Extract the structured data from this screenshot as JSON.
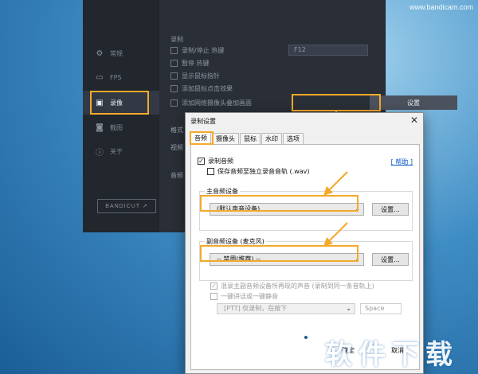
{
  "watermark_top": "www.bandicam.com",
  "main_window": {
    "sidebar": {
      "items": [
        {
          "label": "常规",
          "icon": "gear-icon"
        },
        {
          "label": "FPS",
          "icon": "fps-icon"
        },
        {
          "label": "录像",
          "icon": "video-icon"
        },
        {
          "label": "截图",
          "icon": "camera-icon"
        },
        {
          "label": "关于",
          "icon": "info-icon"
        }
      ],
      "bandicut": "BANDICUT ↗"
    },
    "section_title": "录制",
    "options": [
      "录制/停止 热键",
      "暂停 热键",
      "显示鼠标指针",
      "添加鼠标点击效果",
      "添加网络摄像头叠加画面"
    ],
    "hotkey_value": "F12",
    "format_label": "格式",
    "video_label": "视频",
    "audio_label": "音频",
    "settings_button": "设置"
  },
  "dialog": {
    "title": "录制设置",
    "close": "✕",
    "tabs": [
      "音频",
      "摄像头",
      "鼠标",
      "水印",
      "选项"
    ],
    "record_audio": "录制音频",
    "save_separate": "保存音频至独立录音音轨 (.wav)",
    "help": "[ 帮助 ]",
    "primary_group": "主音频设备",
    "primary_device": "(默认声音设备)",
    "secondary_group": "副音频设备 (麦克风)",
    "secondary_device": "-- 禁用(推荐) --",
    "settings_btn": "设置...",
    "mix_audio": "混录主副音频设备所再现的声音 (录制到同一条音轨上)",
    "ptt": "一键讲话或一键静音",
    "ptt_mode": "[PTT] 仅录制，在按下",
    "ptt_key": "Space",
    "ok": "确定",
    "cancel": "取消"
  },
  "watermark_site": "软件下载",
  "colors": {
    "highlight": "#f4a92a",
    "sidebar_bg": "#22262d",
    "link": "#0a58ca"
  }
}
